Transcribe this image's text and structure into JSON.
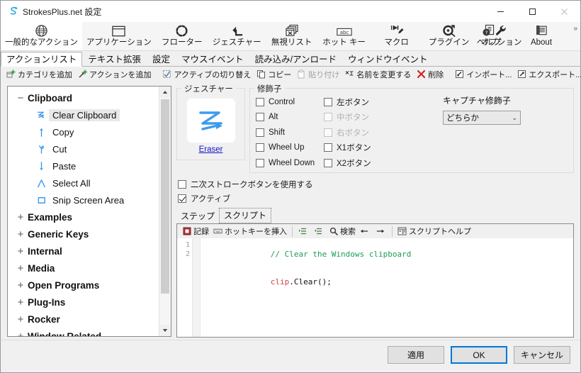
{
  "window": {
    "title": "StrokesPlus.net 設定",
    "app_icon": "strokesplus-logo-icon",
    "controls": {
      "minimize": "−",
      "maximize": "▢",
      "close": "✕"
    }
  },
  "ribbon": {
    "overflow": "»",
    "items": [
      {
        "label": "一般的なアクション",
        "icon": "globe-icon",
        "selected": true
      },
      {
        "label": "アプリケーション",
        "icon": "window-icon",
        "selected": false
      },
      {
        "label": "フローター",
        "icon": "dotted-circle-icon",
        "selected": false
      },
      {
        "label": "ジェスチャー",
        "icon": "arrow-turn-icon",
        "selected": false
      },
      {
        "label": "無視リスト",
        "icon": "stacked-windows-x-icon",
        "selected": false
      },
      {
        "label": "ホット キー",
        "icon": "abc-key-icon",
        "selected": false
      },
      {
        "label": "マクロ",
        "icon": "macro-record-icon",
        "selected": false
      },
      {
        "label": "プラグイン",
        "icon": "plugin-gear-icon",
        "selected": false
      },
      {
        "label": "オプション",
        "icon": "wrench-icon",
        "selected": false
      }
    ],
    "right_items": [
      {
        "label": "ヘルプ",
        "icon": "help-document-icon"
      },
      {
        "label": "About",
        "icon": "about-info-icon"
      }
    ]
  },
  "tabs": {
    "items": [
      {
        "label": "アクションリスト",
        "active": true
      },
      {
        "label": "テキスト拡張",
        "active": false
      },
      {
        "label": "設定",
        "active": false
      },
      {
        "label": "マウスイベント",
        "active": false
      },
      {
        "label": "読み込み/アンロード",
        "active": false
      },
      {
        "label": "ウィンドウイベント",
        "active": false
      }
    ]
  },
  "action_toolbar": {
    "items": [
      {
        "label": "カテゴリを追加",
        "icon": "add-category-icon",
        "disabled": false
      },
      {
        "label": "アクションを追加",
        "icon": "add-action-icon",
        "disabled": false
      },
      {
        "separator_before": true,
        "label": "アクティブの切り替え",
        "icon": "toggle-active-icon",
        "disabled": false
      },
      {
        "label": "コピー",
        "icon": "copy-icon",
        "disabled": false
      },
      {
        "label": "貼り付け",
        "icon": "paste-icon",
        "disabled": true
      },
      {
        "label": "名前を変更する",
        "icon": "rename-icon",
        "disabled": false
      },
      {
        "label": "削除",
        "icon": "delete-x-icon",
        "disabled": false
      },
      {
        "separator_before": true,
        "label": "インポート...",
        "icon": "import-icon",
        "disabled": false
      },
      {
        "label": "エクスポート...",
        "icon": "export-icon",
        "disabled": false
      }
    ]
  },
  "tree": {
    "scrollbar": {
      "up": "▲",
      "down": "▼"
    },
    "nodes": [
      {
        "label": "Clipboard",
        "expanded": true,
        "toggle": "−",
        "children": [
          {
            "label": "Clear Clipboard",
            "icon": "gesture-z-icon",
            "selected": true
          },
          {
            "label": "Copy",
            "icon": "gesture-up-arrow-icon",
            "selected": false
          },
          {
            "label": "Cut",
            "icon": "gesture-loop-icon",
            "selected": false
          },
          {
            "label": "Paste",
            "icon": "gesture-down-arrow-icon",
            "selected": false
          },
          {
            "label": "Select All",
            "icon": "gesture-caret-icon",
            "selected": false
          },
          {
            "label": "Snip Screen Area",
            "icon": "gesture-box-icon",
            "selected": false
          }
        ]
      },
      {
        "label": "Examples",
        "expanded": false,
        "toggle": "+",
        "children": []
      },
      {
        "label": "Generic Keys",
        "expanded": false,
        "toggle": "+",
        "children": []
      },
      {
        "label": "Internal",
        "expanded": false,
        "toggle": "+",
        "children": []
      },
      {
        "label": "Media",
        "expanded": false,
        "toggle": "+",
        "children": []
      },
      {
        "label": "Open Programs",
        "expanded": false,
        "toggle": "+",
        "children": []
      },
      {
        "label": "Plug-Ins",
        "expanded": false,
        "toggle": "+",
        "children": []
      },
      {
        "label": "Rocker",
        "expanded": false,
        "toggle": "+",
        "children": []
      },
      {
        "label": "Window Related",
        "expanded": false,
        "toggle": "+",
        "children": []
      }
    ]
  },
  "gesture": {
    "group_label": "ジェスチャー",
    "preview_icon": "gesture-z-stroke-icon",
    "name": "Eraser"
  },
  "modifiers": {
    "group_label": "修飾子",
    "column1": [
      {
        "label": "Control",
        "checked": false,
        "disabled": false
      },
      {
        "label": "Alt",
        "checked": false,
        "disabled": false
      },
      {
        "label": "Shift",
        "checked": false,
        "disabled": false
      },
      {
        "label": "Wheel Up",
        "checked": false,
        "disabled": false
      },
      {
        "label": "Wheel Down",
        "checked": false,
        "disabled": false
      }
    ],
    "column2": [
      {
        "label": "左ボタン",
        "checked": false,
        "disabled": false
      },
      {
        "label": "中ボタン",
        "checked": false,
        "disabled": true
      },
      {
        "label": "右ボタン",
        "checked": false,
        "disabled": true
      },
      {
        "label": "X1ボタン",
        "checked": false,
        "disabled": false
      },
      {
        "label": "X2ボタン",
        "checked": false,
        "disabled": false
      }
    ],
    "capture": {
      "label": "キャプチャ修飾子",
      "value": "どちらか",
      "chevron": "⌄",
      "options": [
        "どちらか"
      ]
    }
  },
  "options": [
    {
      "label": "二次ストロークボタンを使用する",
      "checked": false
    },
    {
      "label": "アクティブ",
      "checked": true
    }
  ],
  "sub_tabs": {
    "items": [
      {
        "label": "ステップ",
        "active": false
      },
      {
        "label": "スクリプト",
        "active": true
      }
    ]
  },
  "script_toolbar": {
    "items": [
      {
        "label": "記録",
        "icon": "record-icon"
      },
      {
        "label": "ホットキーを挿入",
        "icon": "insert-hotkey-icon"
      },
      {
        "separator_before": true,
        "label": "",
        "icon": "indent-icon"
      },
      {
        "label": "",
        "icon": "outdent-icon"
      },
      {
        "label": "検索",
        "icon": "search-icon"
      },
      {
        "label": "",
        "icon": "arrow-left-icon"
      },
      {
        "label": "",
        "icon": "arrow-right-icon"
      },
      {
        "separator_before": true,
        "label": "スクリプトヘルプ",
        "icon": "script-help-icon"
      }
    ]
  },
  "editor": {
    "line_numbers": [
      "1",
      "2"
    ],
    "lines": [
      {
        "comment": "// Clear the Windows clipboard"
      },
      {
        "object": "clip",
        "rest": ".Clear();"
      }
    ]
  },
  "footer": {
    "apply": "適用",
    "ok": "OK",
    "cancel": "キャンセル"
  },
  "colors": {
    "accent": "#0078d7",
    "gesture_blue": "#3d9bee",
    "link": "#1414c8",
    "comment_green": "#1f9d55",
    "keyword_red": "#d14545"
  }
}
